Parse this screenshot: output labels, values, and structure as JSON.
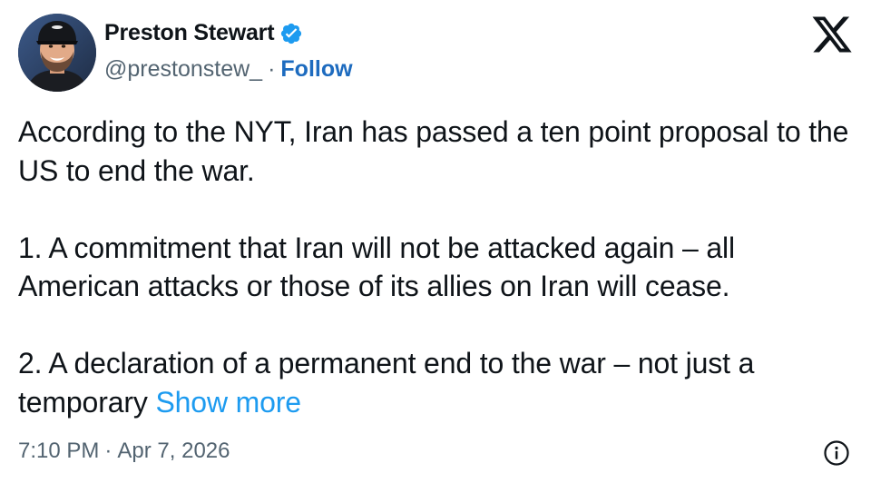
{
  "author": {
    "name": "Preston Stewart",
    "handle": "@prestonstew_",
    "separator": "·",
    "follow_label": "Follow",
    "verified_color": "#1d9bf0"
  },
  "platform_icon": "x-logo-icon",
  "tweet": {
    "line_intro": "According to the NYT, Iran has passed a ten point proposal to the US to end the war.",
    "point_1": "1. A commitment that Iran will not be attacked again – all American attacks or those of its allies on Iran will cease.",
    "point_2": "2. A declaration of a permanent end to the war – not just a temporary",
    "show_more_label": "Show more"
  },
  "footer": {
    "time": "7:10 PM",
    "separator": "·",
    "date": "Apr 7, 2026",
    "info_icon": "info-icon"
  },
  "colors": {
    "text": "#0f1419",
    "secondary": "#536471",
    "link": "#1d9bf0",
    "follow": "#1d6bbf"
  }
}
